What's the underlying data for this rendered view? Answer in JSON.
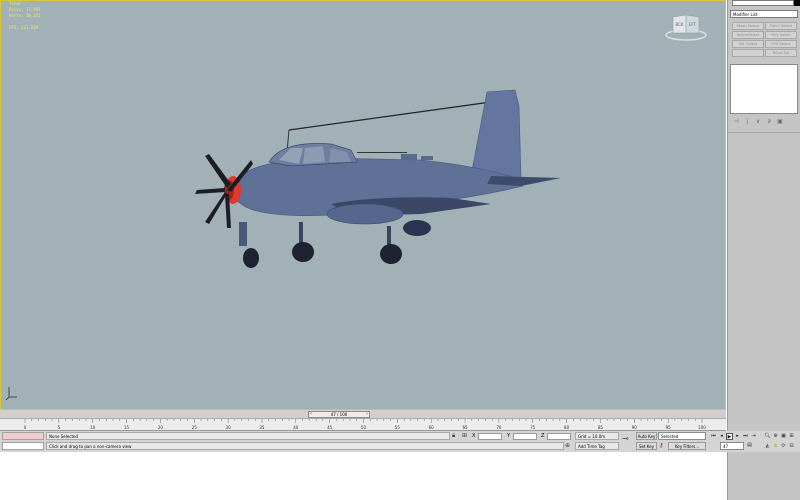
{
  "viewport": {
    "stats": [
      "Total",
      "Polys: 17,983",
      "Verts: 10,251",
      "FPS: 221.238"
    ],
    "viewcube": {
      "left_face": "BCK",
      "right_face": "LFT"
    }
  },
  "command_panel": {
    "modifier_list": "Modifier List",
    "buttons": [
      "Mesh Select",
      "Patch Select",
      "SplineSelect",
      "Poly Select",
      "Vol. Select",
      "FFD Select",
      "",
      "NSurf Sel"
    ]
  },
  "timeline": {
    "slider_label": "47 / 100",
    "ruler_ticks": [
      "0",
      "5",
      "10",
      "15",
      "20",
      "25",
      "30",
      "35",
      "40",
      "45",
      "50",
      "55",
      "60",
      "65",
      "70",
      "75",
      "80",
      "85",
      "90",
      "95",
      "100"
    ]
  },
  "status": {
    "selection": "None Selected",
    "prompt": "Click and drag to pan a non-camera view",
    "x_label": "X",
    "y_label": "Y",
    "z_label": "Z",
    "x_value": "",
    "y_value": "",
    "z_value": "",
    "grid": "Grid = 10.0m",
    "add_time_tag": "Add Time Tag",
    "auto_key": "Auto Key",
    "set_key": "Set Key",
    "selected_dropdown": "Selected",
    "key_filters": "Key Filters...",
    "current_frame": "47"
  },
  "colors": {
    "viewport_bg": "#a1b1b6",
    "viewport_border": "#d8c63a",
    "stats_text": "#f3e86d",
    "plane_body": "#5f7196",
    "spinner": "#e23a2a",
    "panel_bg": "#c5c5c5"
  },
  "icons": {
    "lock": "lock-icon",
    "abs_mode": "absolute-mode-icon",
    "key": "key-icon",
    "add_tag": "time-tag-icon"
  }
}
